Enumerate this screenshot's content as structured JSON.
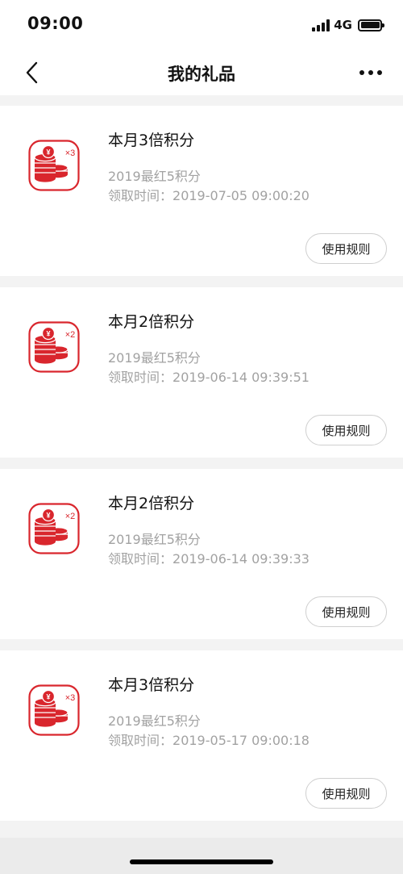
{
  "status_bar": {
    "time": "09:00",
    "network": "4G"
  },
  "nav": {
    "title": "我的礼品"
  },
  "colors": {
    "accent": "#d9262d",
    "muted_text": "#a2a2a2",
    "background": "#f3f3f3"
  },
  "gifts": [
    {
      "name": "本月3倍积分",
      "source": "2019最红5积分",
      "time_label": "领取时间：",
      "time": "2019-07-05 09:00:20",
      "multiplier": "×3",
      "icon": "coins-icon",
      "button": "使用规则"
    },
    {
      "name": "本月2倍积分",
      "source": "2019最红5积分",
      "time_label": "领取时间：",
      "time": "2019-06-14 09:39:51",
      "multiplier": "×2",
      "icon": "coins-icon",
      "button": "使用规则"
    },
    {
      "name": "本月2倍积分",
      "source": "2019最红5积分",
      "time_label": "领取时间：",
      "time": "2019-06-14 09:39:33",
      "multiplier": "×2",
      "icon": "coins-icon",
      "button": "使用规则"
    },
    {
      "name": "本月3倍积分",
      "source": "2019最红5积分",
      "time_label": "领取时间：",
      "time": "2019-05-17 09:00:18",
      "multiplier": "×3",
      "icon": "coins-icon",
      "button": "使用规则"
    }
  ]
}
